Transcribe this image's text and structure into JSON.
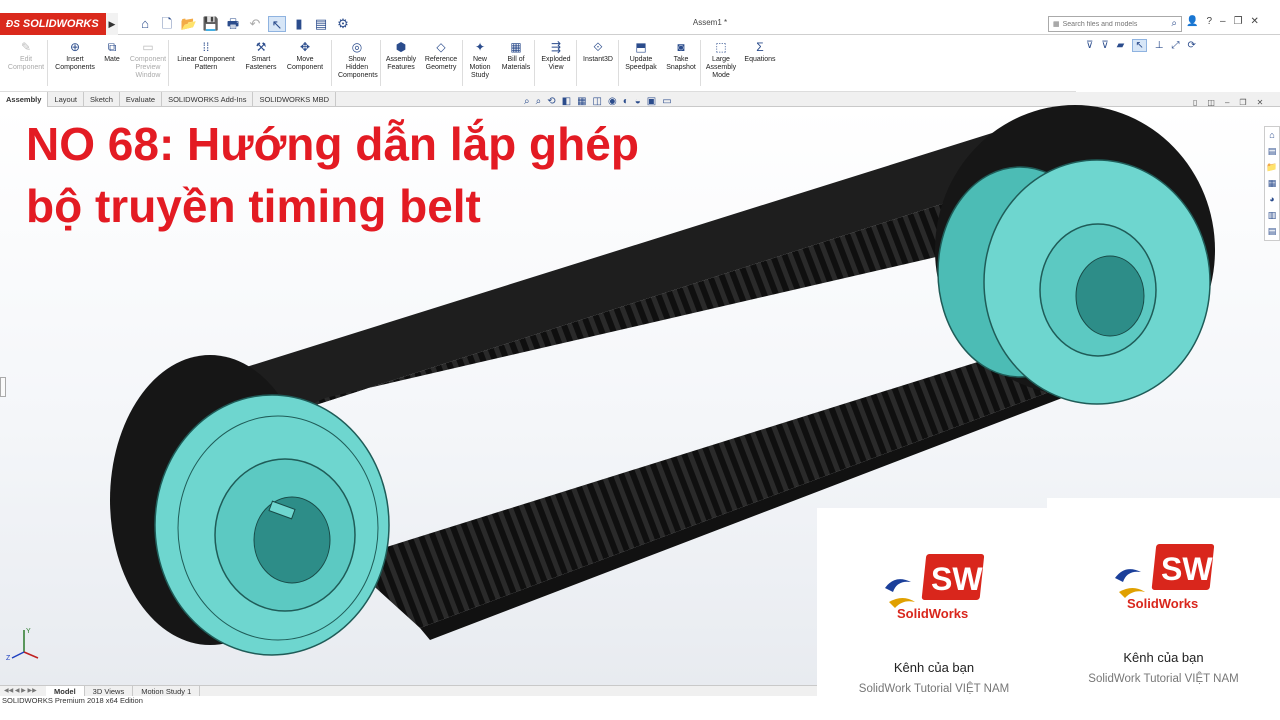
{
  "app": {
    "brand": "SOLIDWORKS",
    "document_title": "Assem1 *",
    "search_placeholder": "Search files and models"
  },
  "commands": [
    {
      "label": "Edit\nComponent",
      "icon": "edit-component-icon",
      "disabled": true
    },
    {
      "label": "Insert\nComponents",
      "icon": "insert-components-icon",
      "disabled": false
    },
    {
      "label": "Mate",
      "icon": "mate-icon",
      "disabled": false
    },
    {
      "label": "Component\nPreview\nWindow",
      "icon": "component-preview-icon",
      "disabled": true
    },
    {
      "label": "Linear Component\nPattern",
      "icon": "linear-pattern-icon",
      "disabled": false
    },
    {
      "label": "Smart\nFasteners",
      "icon": "smart-fasteners-icon",
      "disabled": false
    },
    {
      "label": "Move\nComponent",
      "icon": "move-component-icon",
      "disabled": false
    },
    {
      "label": "Show\nHidden\nComponents",
      "icon": "show-hidden-icon",
      "disabled": false
    },
    {
      "label": "Assembly\nFeatures",
      "icon": "assembly-features-icon",
      "disabled": false
    },
    {
      "label": "Reference\nGeometry",
      "icon": "reference-geometry-icon",
      "disabled": false
    },
    {
      "label": "New\nMotion\nStudy",
      "icon": "motion-study-icon",
      "disabled": false
    },
    {
      "label": "Bill of\nMaterials",
      "icon": "bom-icon",
      "disabled": false
    },
    {
      "label": "Exploded\nView",
      "icon": "exploded-view-icon",
      "disabled": false
    },
    {
      "label": "Instant3D",
      "icon": "instant3d-icon",
      "disabled": false
    },
    {
      "label": "Update\nSpeedpak",
      "icon": "speedpak-icon",
      "disabled": false
    },
    {
      "label": "Take\nSnapshot",
      "icon": "snapshot-icon",
      "disabled": false
    },
    {
      "label": "Large\nAssembly\nMode",
      "icon": "large-assembly-icon",
      "disabled": false
    },
    {
      "label": "Equations",
      "icon": "equations-icon",
      "disabled": false
    }
  ],
  "tabs": [
    "Assembly",
    "Layout",
    "Sketch",
    "Evaluate",
    "SOLIDWORKS Add-Ins",
    "SOLIDWORKS MBD"
  ],
  "active_tab": "Assembly",
  "headline": {
    "line1": "NO 68: Hướng dẫn lắp ghép",
    "line2": "bộ truyền timing belt"
  },
  "colors": {
    "headline": "#e31b23",
    "pulley": "#6ed6cf",
    "belt": "#1c1c1c",
    "brand_red": "#da291c"
  },
  "cards": [
    {
      "logo_text": "SolidWorks",
      "badge": "SW",
      "name": "Kênh của bạn",
      "subtitle": "SolidWork Tutorial VIỆT NAM"
    },
    {
      "logo_text": "SolidWorks",
      "badge": "SW",
      "name": "Kênh của bạn",
      "subtitle": "SolidWork Tutorial VIỆT NAM"
    }
  ],
  "bottom_tabs": [
    "Model",
    "3D Views",
    "Motion Study 1"
  ],
  "active_bottom_tab": "Model",
  "status_text": "SOLIDWORKS Premium 2018 x64 Edition"
}
